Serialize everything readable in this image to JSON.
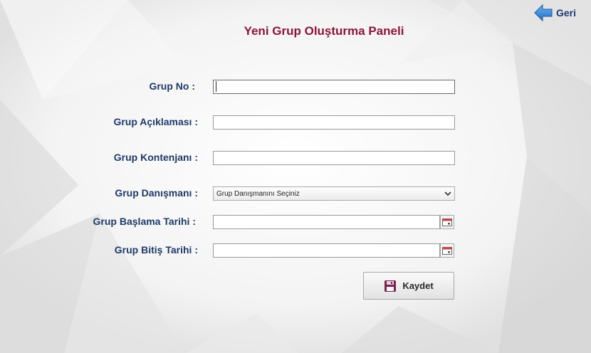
{
  "header": {
    "back_label": "Geri",
    "title": "Yeni Grup Oluşturma Paneli"
  },
  "form": {
    "group_no": {
      "label": "Grup No :",
      "value": ""
    },
    "description": {
      "label": "Grup Açıklaması :",
      "value": ""
    },
    "quota": {
      "label": "Grup Kontenjanı :",
      "value": ""
    },
    "advisor": {
      "label": "Grup Danışmanı :",
      "selected": "Grup Danışmanını Seçiniz"
    },
    "start_date": {
      "label": "Grup Başlama Tarihi :",
      "value": ""
    },
    "end_date": {
      "label": "Grup Bitiş Tarihi :",
      "value": ""
    }
  },
  "actions": {
    "save_label": "Kaydet"
  },
  "colors": {
    "title": "#8b1538",
    "label": "#1f3a68",
    "back_arrow": "#2f7fd6",
    "save_icon": "#7b2350"
  },
  "icons": {
    "back": "arrow-left-icon",
    "calendar": "calendar-icon",
    "dropdown": "chevron-down-icon",
    "save": "floppy-disk-icon"
  }
}
